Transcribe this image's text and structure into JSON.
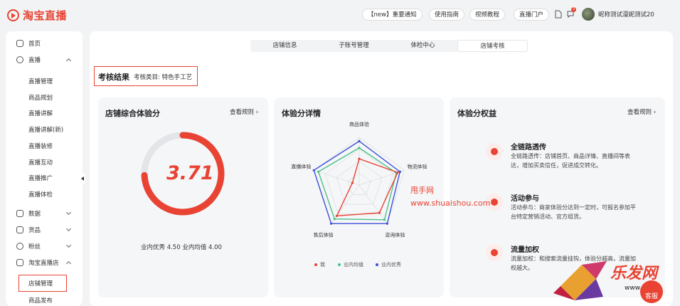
{
  "header": {
    "logo_text": "淘宝直播",
    "pills": [
      "【new】重要通知",
      "使用指南",
      "视频教程",
      "直播门户"
    ],
    "notification_count": "3",
    "username": "昵称测试漫妮测试20"
  },
  "sidebar": {
    "groups": [
      {
        "label": "首页",
        "icon": "home-icon"
      },
      {
        "label": "直播",
        "icon": "live-icon",
        "expanded": true
      },
      {
        "label": "数据",
        "icon": "chart-icon"
      },
      {
        "label": "货品",
        "icon": "goods-icon"
      },
      {
        "label": "粉丝",
        "icon": "fans-icon"
      },
      {
        "label": "淘宝直播店",
        "icon": "store-icon",
        "expanded": true
      }
    ],
    "live_subitems": [
      "直播管理",
      "商品规划",
      "直播讲解",
      "直播讲解(新)",
      "直播装修",
      "直播互动",
      "直播推广",
      "直播体检"
    ],
    "store_subitems": [
      "店铺管理",
      "商品发布"
    ]
  },
  "tabs": [
    "店铺信息",
    "子账号管理",
    "体检中心",
    "店铺考核"
  ],
  "result": {
    "title": "考核结果",
    "category": "考核类目: 特色手工艺"
  },
  "cards": {
    "score": {
      "title": "店铺综合体验分",
      "link": "查看规则",
      "score_value": "3.71",
      "score_fraction": 0.742,
      "subtext": "业内优秀 4.50   业内均值 4.00"
    },
    "detail": {
      "title": "体验分详情",
      "legend": [
        {
          "name": "我",
          "color": "#e84333"
        },
        {
          "name": "业内均值",
          "color": "#4cc08a"
        },
        {
          "name": "业内优秀",
          "color": "#3d4fd8"
        }
      ]
    },
    "benefits": {
      "title": "体验分权益",
      "link": "查看规则",
      "items": [
        {
          "title": "全链路透传",
          "desc": "全链路透传：店铺首页、商品详情、直播间等表达，增加买卖信任，促进成交转化。"
        },
        {
          "title": "活动参与",
          "desc": "活动参与：商家体验分达到一定时，可报名参加平台特定营销活动、官方组货。"
        },
        {
          "title": "流量加权",
          "desc": "流量加权：和搜索流量挂钩，体验分越高，流量加权越大。"
        }
      ]
    }
  },
  "chart_data": {
    "type": "radar",
    "categories": [
      "商品体验",
      "物流体验",
      "咨询体验",
      "售后体验",
      "直播体验"
    ],
    "series": [
      {
        "name": "我",
        "values": [
          0.55,
          0.85,
          0.72,
          0.8,
          0.15
        ]
      },
      {
        "name": "业内均值",
        "values": [
          0.78,
          0.82,
          0.9,
          0.88,
          0.9
        ]
      },
      {
        "name": "业内优秀",
        "values": [
          0.92,
          0.9,
          1.0,
          1.0,
          1.0
        ]
      }
    ],
    "colors": [
      "#e84333",
      "#4cc08a",
      "#3d4fd8"
    ],
    "ylim": [
      0,
      1
    ]
  },
  "watermarks": [
    "甩手网",
    "www.shuaishou.com",
    "乐发网",
    "www.cpf.cn"
  ],
  "service_button": "客服"
}
